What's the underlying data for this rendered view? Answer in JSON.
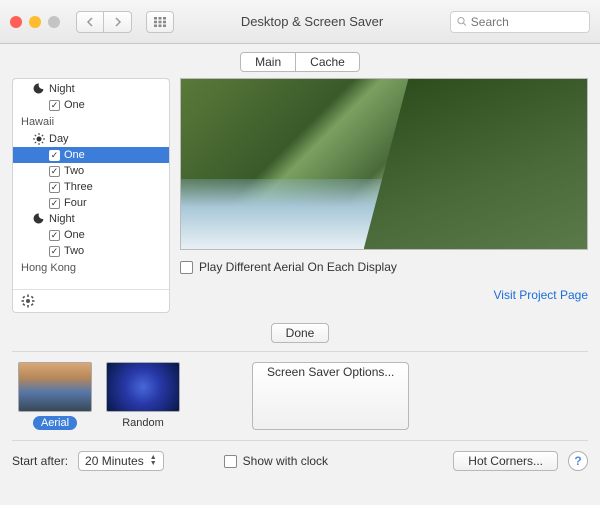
{
  "window": {
    "title": "Desktop & Screen Saver",
    "search_placeholder": "Search"
  },
  "tabs": {
    "main": "Main",
    "cache": "Cache"
  },
  "sidebar": {
    "groups": [
      {
        "name": "previous_tail",
        "subgroups": [
          {
            "label": "Night",
            "icon": "moon",
            "items": [
              {
                "label": "One",
                "checked": true
              }
            ]
          }
        ]
      },
      {
        "name": "Hawaii",
        "label": "Hawaii",
        "subgroups": [
          {
            "label": "Day",
            "icon": "sun",
            "items": [
              {
                "label": "One",
                "checked": true,
                "selected": true
              },
              {
                "label": "Two",
                "checked": true
              },
              {
                "label": "Three",
                "checked": true
              },
              {
                "label": "Four",
                "checked": true
              }
            ]
          },
          {
            "label": "Night",
            "icon": "moon",
            "items": [
              {
                "label": "One",
                "checked": true
              },
              {
                "label": "Two",
                "checked": true
              }
            ]
          }
        ]
      },
      {
        "name": "Hong Kong",
        "label": "Hong Kong",
        "subgroups": []
      }
    ]
  },
  "play_different_label": "Play Different Aerial On Each Display",
  "play_different_checked": false,
  "visit_link": "Visit Project Page",
  "done_button": "Done",
  "screen_saver_options_button": "Screen Saver Options...",
  "savers": [
    {
      "id": "aerial",
      "label": "Aerial",
      "selected": true
    },
    {
      "id": "random",
      "label": "Random",
      "selected": false
    }
  ],
  "start_after_label": "Start after:",
  "start_after_value": "20 Minutes",
  "show_with_clock_label": "Show with clock",
  "show_with_clock_checked": false,
  "hot_corners_button": "Hot Corners...",
  "help_label": "?"
}
